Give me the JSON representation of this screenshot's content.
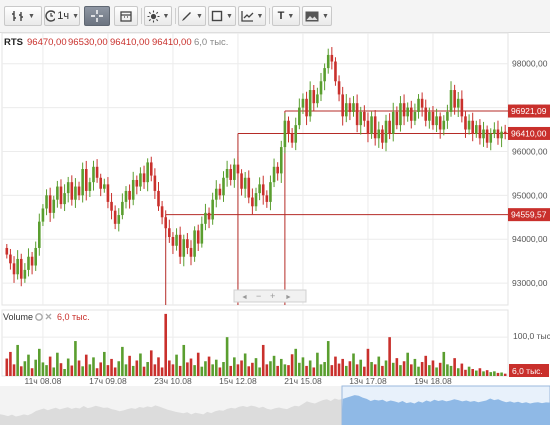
{
  "toolbar": {
    "buttons": [
      {
        "name": "bars-type-button",
        "icon": "bar-chart-icon",
        "label": ""
      },
      {
        "name": "timeframe-button",
        "icon": "clock-icon",
        "label": "1ч"
      },
      {
        "name": "crosshair-button",
        "icon": "crosshair-icon",
        "label": ""
      },
      {
        "name": "calendar-button",
        "icon": "calendar-icon",
        "label": ""
      },
      {
        "name": "indicators-button",
        "icon": "sun-icon",
        "label": ""
      },
      {
        "name": "draw-line-button",
        "icon": "pencil-icon",
        "label": ""
      },
      {
        "name": "shapes-button",
        "icon": "square-icon",
        "label": ""
      },
      {
        "name": "studies-button",
        "icon": "trend-icon",
        "label": ""
      },
      {
        "name": "text-button",
        "icon": "text-icon",
        "label": "T"
      },
      {
        "name": "image-button",
        "icon": "image-icon",
        "label": ""
      }
    ]
  },
  "info": {
    "symbol": "RTS",
    "open": "96470,00",
    "high": "96530,00",
    "low": "96410,00",
    "close": "96410,00",
    "volume": "6,0 тыс."
  },
  "volume_panel": {
    "title": "Volume",
    "value": "6,0 тыс.",
    "axis_label": "100,0 тыс.",
    "badge": "6,0 тыс."
  },
  "nav": {
    "left": "◄",
    "minus": "−",
    "plus": "+",
    "right": "►"
  },
  "price_badges": [
    {
      "value": "96921,09",
      "price": 96921.09
    },
    {
      "value": "96410,00",
      "price": 96410
    },
    {
      "value": "94559,57",
      "price": 94559.57
    }
  ],
  "chart_data": {
    "type": "candlestick",
    "ylim": [
      92500,
      98700
    ],
    "y_ticks": [
      {
        "label": "98000,00",
        "value": 98000
      },
      {
        "label": "97000,00",
        "value": 97000
      },
      {
        "label": "96000,00",
        "value": 96000
      },
      {
        "label": "95000,00",
        "value": 95000
      },
      {
        "label": "94000,00",
        "value": 94000
      },
      {
        "label": "93000,00",
        "value": 93000
      }
    ],
    "x_ticks": [
      {
        "label": "11ч 08.08",
        "index": 10
      },
      {
        "label": "17ч 09.08",
        "index": 28
      },
      {
        "label": "23ч 10.08",
        "index": 46
      },
      {
        "label": "15ч 12.08",
        "index": 64
      },
      {
        "label": "21ч 15.08",
        "index": 82
      },
      {
        "label": "13ч 17.08",
        "index": 100
      },
      {
        "label": "19ч 18.08",
        "index": 118
      }
    ],
    "levels": [
      {
        "value": 96921.09,
        "from_index": 77
      },
      {
        "value": 96410,
        "from_index": 64
      },
      {
        "value": 94559.57,
        "from_index": 44
      }
    ],
    "candles_close": [
      93650,
      93450,
      93200,
      93550,
      93100,
      93300,
      93600,
      93400,
      93800,
      94400,
      94700,
      95000,
      94600,
      94900,
      95200,
      94800,
      95050,
      95300,
      94900,
      95200,
      95000,
      95600,
      95100,
      95300,
      95650,
      95400,
      95150,
      95250,
      94850,
      94650,
      94350,
      94550,
      94850,
      95100,
      94900,
      95350,
      95200,
      95500,
      95300,
      95750,
      95450,
      95100,
      94750,
      94500,
      94250,
      94050,
      93850,
      94100,
      93600,
      94000,
      93800,
      93600,
      94200,
      93900,
      94350,
      94600,
      94450,
      94900,
      95150,
      95000,
      95400,
      95600,
      95350,
      95700,
      95500,
      95150,
      95400,
      94950,
      94750,
      95050,
      95250,
      95000,
      94850,
      95300,
      95650,
      95500,
      96100,
      96700,
      96400,
      96200,
      96600,
      97000,
      97200,
      96800,
      97400,
      97100,
      97300,
      97600,
      97900,
      98200,
      98050,
      97600,
      97300,
      96800,
      97100,
      96900,
      97100,
      96600,
      96900,
      96700,
      96400,
      96800,
      96300,
      96500,
      96200,
      96700,
      96400,
      96900,
      96600,
      97100,
      96800,
      97000,
      96700,
      96900,
      97200,
      97000,
      96700,
      96900,
      96600,
      96800,
      96500,
      96700,
      96900,
      97400,
      97000,
      97200,
      96800,
      96500,
      96700,
      96400,
      96600,
      96300,
      96500,
      96200,
      96400,
      96500,
      96300,
      96450,
      96400
    ],
    "volume": {
      "ylim": [
        0,
        170000
      ],
      "tick_label": "100,0 тыс.",
      "tick_value": 100000,
      "values": [
        45000,
        62000,
        30000,
        80000,
        25000,
        38000,
        55000,
        20000,
        42000,
        70000,
        35000,
        28000,
        50000,
        22000,
        60000,
        33000,
        18000,
        45000,
        27000,
        90000,
        40000,
        25000,
        55000,
        30000,
        48000,
        20000,
        35000,
        62000,
        28000,
        44000,
        22000,
        38000,
        75000,
        30000,
        52000,
        26000,
        40000,
        58000,
        24000,
        36000,
        66000,
        30000,
        48000,
        22000,
        160000,
        40000,
        30000,
        55000,
        26000,
        80000,
        35000,
        45000,
        28000,
        60000,
        24000,
        38000,
        50000,
        30000,
        42000,
        22000,
        36000,
        100000,
        26000,
        48000,
        30000,
        40000,
        58000,
        25000,
        34000,
        46000,
        22000,
        80000,
        30000,
        38000,
        52000,
        26000,
        44000,
        30000,
        28000,
        56000,
        70000,
        34000,
        48000,
        26000,
        40000,
        22000,
        60000,
        30000,
        36000,
        90000,
        28000,
        50000,
        32000,
        44000,
        26000,
        38000,
        58000,
        30000,
        42000,
        24000,
        70000,
        36000,
        30000,
        50000,
        26000,
        40000,
        100000,
        34000,
        46000,
        28000,
        38000,
        60000,
        30000,
        44000,
        24000,
        36000,
        52000,
        28000,
        40000,
        22000,
        34000,
        62000,
        30000,
        26000,
        46000,
        20000,
        32000,
        16000,
        24000,
        18000,
        14000,
        20000,
        12000,
        15000,
        10000,
        12000,
        8000,
        9000,
        6000
      ]
    }
  }
}
